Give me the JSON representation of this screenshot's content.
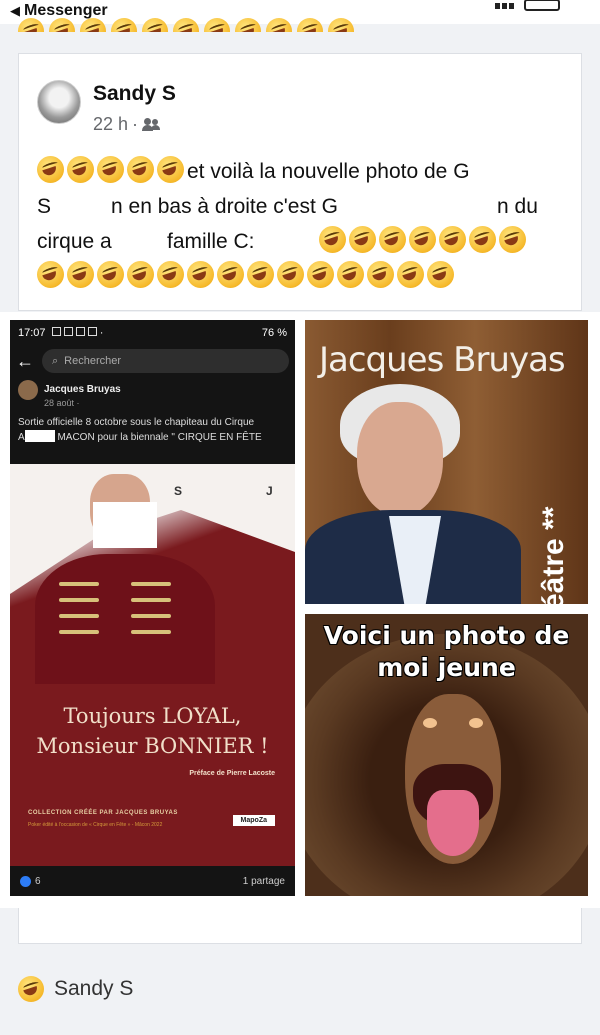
{
  "status_bar": {
    "back_label": "Messenger"
  },
  "post": {
    "author": "Sandy S",
    "time": "22 h",
    "meta_sep": "·",
    "text_line1_after_emoji": "et voilà la nouvelle photo de G",
    "text_line2_left": "S",
    "text_line2_mid": "n en bas à droite c'est G",
    "text_line2_right": "n du",
    "text_line3_left": "cirque a",
    "text_line3_mid": "famille C:"
  },
  "images": {
    "screenshot": {
      "time": "17:07",
      "battery": "76 %",
      "search_placeholder": "Rechercher",
      "inner_author": "Jacques Bruyas",
      "inner_date": "28 août · ",
      "inner_body_1": "Sortie officielle 8 octobre sous le chapiteau du Cirque",
      "inner_body_2a": "A",
      "inner_body_2b": "MACON pour la biennale \" CIRQUE EN FÊTE",
      "cover_title_1": "Toujours LOYAL,",
      "cover_title_2": "Monsieur BONNIER !",
      "cover_preface": "Préface de Pierre Lacoste",
      "cover_collection": "COLLECTION CRÉÉE PAR JACQUES BRUYAS",
      "cover_small": "Poker édité à l'occasion de « Cirque en Fête » - Mâcon 2022",
      "cover_edition": "MapoZa",
      "reactions_count": "6",
      "shares": "1 partage",
      "cover_letter_s": "S",
      "cover_letter_j": "J"
    },
    "portrait": {
      "name": "Jacques Bruyas",
      "vertical_text": "éâtre **"
    },
    "monkey": {
      "caption_1": "Voici un photo de",
      "caption_2": "moi jeune"
    }
  },
  "next_post": {
    "author": "Sandy S"
  }
}
